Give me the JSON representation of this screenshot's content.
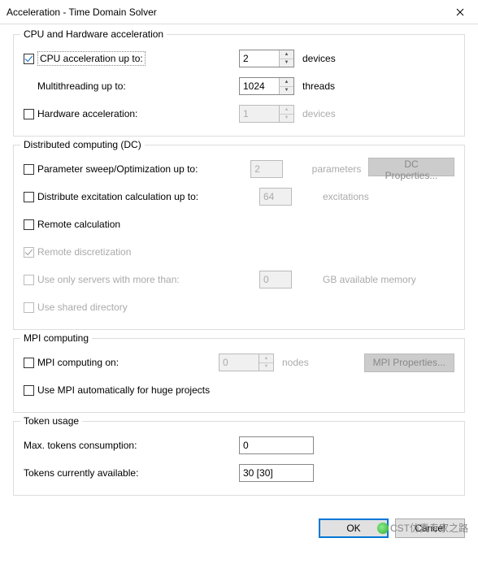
{
  "title": "Acceleration - Time Domain Solver",
  "groups": {
    "cpu": {
      "title": "CPU and Hardware acceleration",
      "cpu_accel_label": "CPU acceleration up to:",
      "cpu_accel_value": "2",
      "cpu_accel_unit": "devices",
      "multithread_label": "Multithreading up to:",
      "multithread_value": "1024",
      "multithread_unit": "threads",
      "hw_accel_label": "Hardware acceleration:",
      "hw_accel_value": "1",
      "hw_accel_unit": "devices"
    },
    "dc": {
      "title": "Distributed computing (DC)",
      "param_sweep_label": "Parameter sweep/Optimization up to:",
      "param_sweep_value": "2",
      "param_sweep_unit": "parameters",
      "dc_props_btn": "DC Properties...",
      "distribute_exc_label": "Distribute excitation calculation up to:",
      "distribute_exc_value": "64",
      "distribute_exc_unit": "excitations",
      "remote_calc_label": "Remote calculation",
      "remote_disc_label": "Remote discretization",
      "use_servers_label": "Use only servers with more than:",
      "use_servers_value": "0",
      "use_servers_unit": "GB available memory",
      "shared_dir_label": "Use shared directory"
    },
    "mpi": {
      "title": "MPI computing",
      "mpi_on_label": "MPI computing on:",
      "mpi_on_value": "0",
      "mpi_on_unit": "nodes",
      "mpi_props_btn": "MPI Properties...",
      "mpi_auto_label": "Use MPI automatically for huge projects"
    },
    "token": {
      "title": "Token usage",
      "max_tokens_label": "Max. tokens consumption:",
      "max_tokens_value": "0",
      "tokens_avail_label": "Tokens currently available:",
      "tokens_avail_value": "30 [30]"
    }
  },
  "buttons": {
    "ok": "OK",
    "cancel": "Cancel"
  },
  "watermark": "CST仿真专家之路"
}
